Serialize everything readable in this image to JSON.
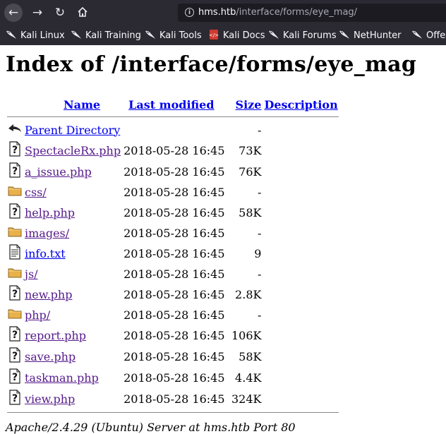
{
  "browser": {
    "url_host": "hms.htb",
    "url_path": "/interface/forms/eye_mag/",
    "bookmarks": [
      {
        "label": "Kali Linux",
        "icon": "kali-dragon-icon"
      },
      {
        "label": "Kali Training",
        "icon": "kali-dragon-icon"
      },
      {
        "label": "Kali Tools",
        "icon": "kali-dragon-icon"
      },
      {
        "label": "Kali Docs",
        "icon": "kali-docs-icon"
      },
      {
        "label": "Kali Forums",
        "icon": "kali-dragon-icon"
      },
      {
        "label": "NetHunter",
        "icon": "kali-dragon-icon"
      },
      {
        "label": "Offensive Security",
        "icon": "kali-dragon-icon"
      }
    ]
  },
  "page": {
    "title": "Index of /interface/forms/eye_mag",
    "columns": {
      "name": "Name",
      "last_modified": "Last modified",
      "size": "Size",
      "description": "Description"
    },
    "rows": [
      {
        "icon": "back-icon",
        "name": "Parent Directory",
        "modified": "",
        "size": "-",
        "visited": false
      },
      {
        "icon": "unknown-file-icon",
        "name": "SpectacleRx.php",
        "modified": "2018-05-28 16:45",
        "size": "73K",
        "visited": true
      },
      {
        "icon": "unknown-file-icon",
        "name": "a_issue.php",
        "modified": "2018-05-28 16:45",
        "size": "76K",
        "visited": true
      },
      {
        "icon": "folder-icon",
        "name": "css/",
        "modified": "2018-05-28 16:45",
        "size": "-",
        "visited": true
      },
      {
        "icon": "unknown-file-icon",
        "name": "help.php",
        "modified": "2018-05-28 16:45",
        "size": "58K",
        "visited": true
      },
      {
        "icon": "folder-icon",
        "name": "images/",
        "modified": "2018-05-28 16:45",
        "size": "-",
        "visited": true
      },
      {
        "icon": "text-file-icon",
        "name": "info.txt",
        "modified": "2018-05-28 16:45",
        "size": "9",
        "visited": false
      },
      {
        "icon": "folder-icon",
        "name": "js/",
        "modified": "2018-05-28 16:45",
        "size": "-",
        "visited": true
      },
      {
        "icon": "unknown-file-icon",
        "name": "new.php",
        "modified": "2018-05-28 16:45",
        "size": "2.8K",
        "visited": true
      },
      {
        "icon": "folder-icon",
        "name": "php/",
        "modified": "2018-05-28 16:45",
        "size": "-",
        "visited": true
      },
      {
        "icon": "unknown-file-icon",
        "name": "report.php",
        "modified": "2018-05-28 16:45",
        "size": "106K",
        "visited": true
      },
      {
        "icon": "unknown-file-icon",
        "name": "save.php",
        "modified": "2018-05-28 16:45",
        "size": "58K",
        "visited": true
      },
      {
        "icon": "unknown-file-icon",
        "name": "taskman.php",
        "modified": "2018-05-28 16:45",
        "size": "4.4K",
        "visited": true
      },
      {
        "icon": "unknown-file-icon",
        "name": "view.php",
        "modified": "2018-05-28 16:45",
        "size": "324K",
        "visited": true
      }
    ],
    "footer": "Apache/2.4.29 (Ubuntu) Server at hms.htb Port 80"
  },
  "colors": {
    "chrome_bg": "#2b2a33",
    "link": "#0000ee",
    "visited_link": "#551a8b"
  }
}
